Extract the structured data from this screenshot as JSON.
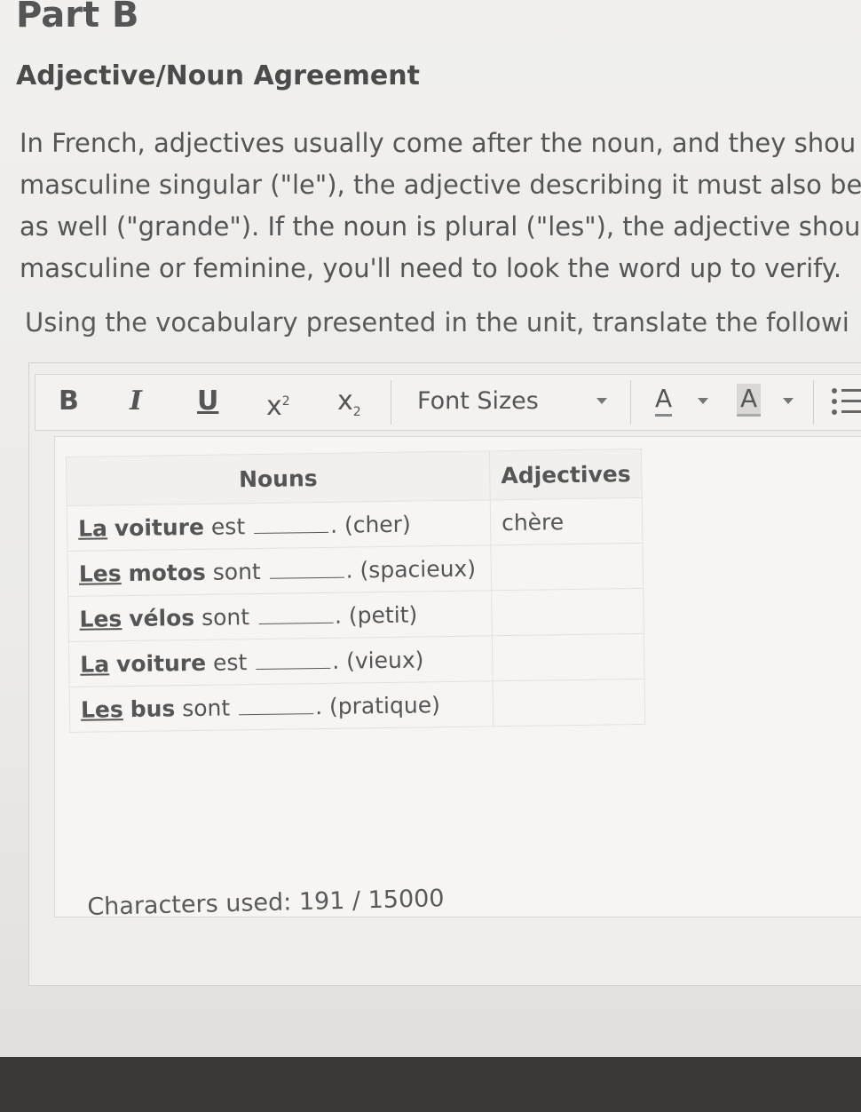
{
  "page": {
    "part_title": "Part B",
    "section_title": "Adjective/Noun Agreement",
    "paragraph_lines": [
      "In French, adjectives usually come after the noun, and they shou",
      "masculine singular (\"le\"), the adjective describing it must also be",
      "as well (\"grande\"). If the noun is plural (\"les\"), the adjective should",
      "masculine or feminine, you'll need to look the word up to verify."
    ],
    "instruction": "Using the vocabulary presented in the unit, translate the followi"
  },
  "toolbar": {
    "bold": "B",
    "italic": "I",
    "underline": "U",
    "superscript": "x",
    "superscript_mark": "2",
    "subscript": "x",
    "subscript_mark": "2",
    "font_sizes": "Font Sizes",
    "text_color": "A",
    "bg_color": "A",
    "list_icon": "list-icon"
  },
  "table": {
    "headers": {
      "nouns": "Nouns",
      "adjectives": "Adjectives"
    },
    "rows": [
      {
        "article": "La",
        "noun": "voiture",
        "verb": "est",
        "hint": ". (cher)",
        "adjective": "chère"
      },
      {
        "article": "Les",
        "noun": "motos",
        "verb": "sont",
        "hint": ". (spacieux)",
        "adjective": ""
      },
      {
        "article": "Les",
        "noun": "vélos",
        "verb": "sont",
        "hint": ". (petit)",
        "adjective": ""
      },
      {
        "article": "La",
        "noun": "voiture",
        "verb": "est",
        "hint": ". (vieux)",
        "adjective": ""
      },
      {
        "article": "Les",
        "noun": "bus",
        "verb": "sont",
        "hint": ". (pratique)",
        "adjective": ""
      }
    ]
  },
  "editor": {
    "counter": "Characters used: 191 / 15000"
  }
}
